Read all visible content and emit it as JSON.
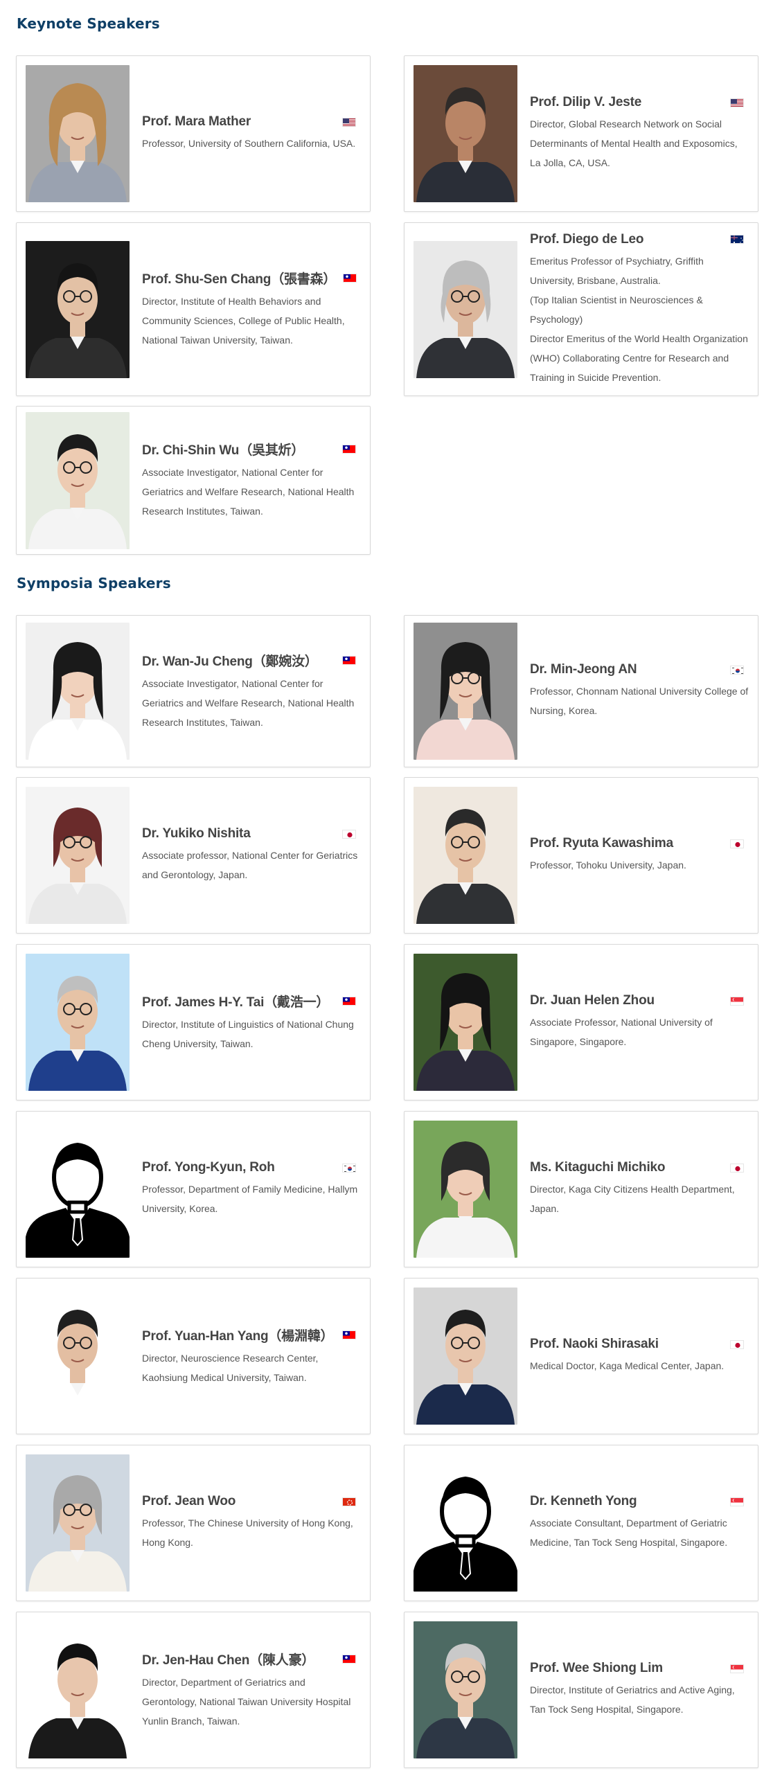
{
  "sections": {
    "keynote_title": "Keynote Speakers",
    "symposia_title": "Symposia Speakers"
  },
  "colors": {
    "heading": "#0f3f66",
    "card_border": "#d8d8d8"
  },
  "keynote": [
    {
      "name": "Prof. Mara Mather",
      "flag": "us-flag-icon",
      "affiliation": "Professor, University of Southern California, USA."
    },
    {
      "name": "Prof. Dilip V. Jeste",
      "flag": "us-flag-icon",
      "affiliation": "Director, Global Research Network on Social Determinants of Mental Health and Exposomics, La Jolla, CA, USA."
    },
    {
      "name": "Prof. Shu-Sen Chang（張書森）",
      "flag": "tw-flag-icon",
      "affiliation": "Director, Institute of Health Behaviors and Community Sciences, College of Public Health, National Taiwan University, Taiwan."
    },
    {
      "name": "Prof. Diego de Leo",
      "flag": "au-flag-icon",
      "affiliation": "Emeritus Professor of Psychiatry, Griffith University, Brisbane, Australia.",
      "affiliation2": "(Top Italian Scientist in Neurosciences & Psychology)",
      "affiliation3": "Director Emeritus of the World Health Organization (WHO) Collaborating Centre for Research and Training in Suicide Prevention."
    },
    {
      "name": "Dr. Chi-Shin Wu（吳其炘）",
      "flag": "tw-flag-icon",
      "affiliation": "Associate Investigator, National Center for Geriatrics and Welfare Research, National Health Research Institutes, Taiwan."
    }
  ],
  "symposia": [
    {
      "name": "Dr. Wan-Ju Cheng（鄭婉汝）",
      "flag": "tw-flag-icon",
      "affiliation": "Associate Investigator, National Center for Geriatrics and Welfare Research, National Health Research Institutes, Taiwan."
    },
    {
      "name": "Dr. Min-Jeong AN",
      "flag": "kr-flag-icon",
      "affiliation": "Professor, Chonnam National University College of Nursing, Korea."
    },
    {
      "name": "Dr. Yukiko Nishita",
      "flag": "jp-flag-icon",
      "affiliation": "Associate professor, National Center for Geriatrics and Gerontology, Japan."
    },
    {
      "name": "Prof. Ryuta Kawashima",
      "flag": "jp-flag-icon",
      "affiliation": "Professor, Tohoku University, Japan."
    },
    {
      "name": "Prof. James H-Y. Tai（戴浩一）",
      "flag": "tw-flag-icon",
      "affiliation": "Director, Institute of Linguistics of National Chung Cheng University, Taiwan."
    },
    {
      "name": "Dr. Juan Helen Zhou",
      "flag": "sg-flag-icon",
      "affiliation": "Associate Professor, National University of Singapore, Singapore."
    },
    {
      "name": "Prof. Yong-Kyun, Roh",
      "flag": "kr-flag-icon",
      "affiliation": "Professor, Department of Family Medicine, Hallym University, Korea."
    },
    {
      "name": "Ms. Kitaguchi Michiko",
      "flag": "jp-flag-icon",
      "affiliation": "Director, Kaga City Citizens Health Department, Japan."
    },
    {
      "name": "Prof. Yuan-Han Yang（楊淵韓）",
      "flag": "tw-flag-icon",
      "affiliation": "Director, Neuroscience Research Center, Kaohsiung Medical University, Taiwan."
    },
    {
      "name": "Prof. Naoki Shirasaki",
      "flag": "jp-flag-icon",
      "affiliation": "Medical Doctor, Kaga Medical Center, Japan."
    },
    {
      "name": "Prof. Jean Woo",
      "flag": "hk-flag-icon",
      "affiliation": "Professor, The Chinese University of Hong Kong, Hong Kong."
    },
    {
      "name": "Dr. Kenneth Yong",
      "flag": "sg-flag-icon",
      "affiliation": "Associate Consultant, Department of Geriatric Medicine, Tan Tock Seng Hospital, Singapore."
    },
    {
      "name": "Dr. Jen-Hau Chen（陳人豪）",
      "flag": "tw-flag-icon",
      "affiliation": "Director, Department of Geriatrics and Gerontology, National Taiwan University Hospital Yunlin Branch, Taiwan."
    },
    {
      "name": "Prof. Wee Shiong Lim",
      "flag": "sg-flag-icon",
      "affiliation": "Director, Institute of Geriatrics and Active Aging, Tan Tock Seng Hospital, Singapore."
    }
  ]
}
